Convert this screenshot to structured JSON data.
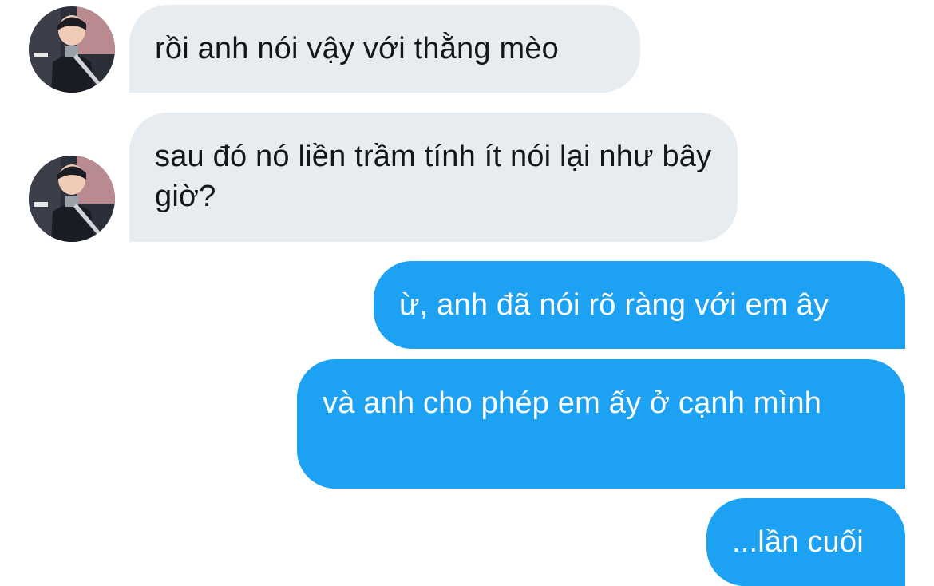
{
  "conversation": {
    "messages": [
      {
        "id": "m1",
        "direction": "incoming",
        "text": "rồi anh nói vậy với thằng mèo",
        "has_avatar": true
      },
      {
        "id": "m2",
        "direction": "incoming",
        "text": "sau đó nó liền trầm tính ít nói lại như bây giờ?",
        "has_avatar": true
      },
      {
        "id": "m3",
        "direction": "outgoing",
        "text": "ừ, anh đã nói rõ ràng với em ây"
      },
      {
        "id": "m4",
        "direction": "outgoing",
        "text": "và anh cho phép em ấy ở cạnh mình"
      },
      {
        "id": "m5",
        "direction": "outgoing",
        "text": "...lần cuối"
      }
    ]
  },
  "colors": {
    "incoming_bubble": "#e6ecf0",
    "incoming_text": "#14171a",
    "outgoing_bubble": "#1da1f2",
    "outgoing_text": "#ffffff",
    "background": "#ffffff"
  },
  "icons": {
    "avatar": "contact-avatar-photo"
  }
}
